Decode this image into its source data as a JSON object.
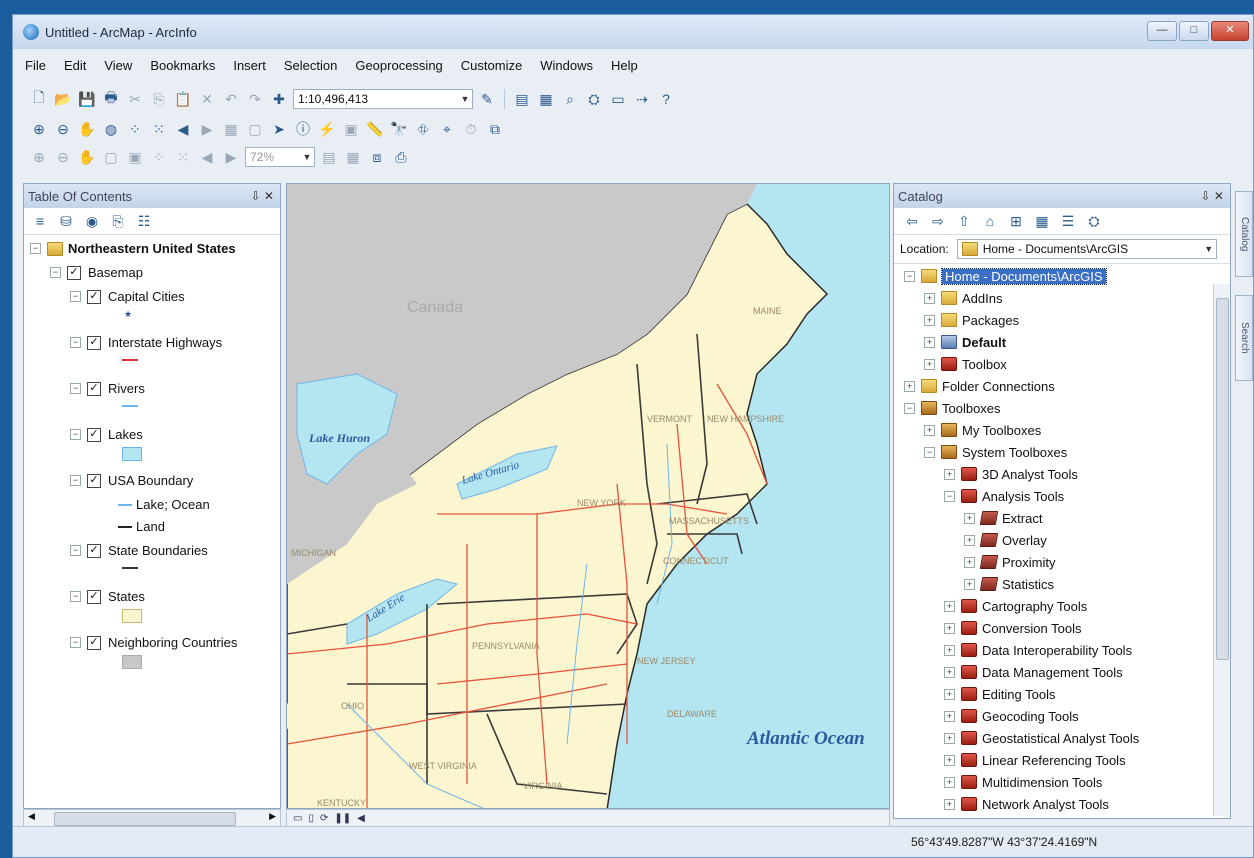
{
  "window": {
    "title": "Untitled - ArcMap - ArcInfo",
    "min": "—",
    "max": "□",
    "close": "✕"
  },
  "menu": [
    "File",
    "Edit",
    "View",
    "Bookmarks",
    "Insert",
    "Selection",
    "Geoprocessing",
    "Customize",
    "Windows",
    "Help"
  ],
  "toolbar": {
    "scale": "1:10,496,413",
    "zoom": "72%"
  },
  "toc": {
    "title": "Table Of Contents",
    "pin": "⇩ ✕",
    "group": "Northeastern United States",
    "basemap": "Basemap",
    "layers": [
      {
        "name": "Capital Cities"
      },
      {
        "name": "Interstate Highways"
      },
      {
        "name": "Rivers"
      },
      {
        "name": "Lakes"
      },
      {
        "name": "USA Boundary",
        "legend": [
          "Lake; Ocean",
          "Land"
        ]
      },
      {
        "name": "State Boundaries"
      },
      {
        "name": "States"
      },
      {
        "name": "Neighboring Countries"
      }
    ]
  },
  "map": {
    "labels": {
      "canada": "Canada",
      "lake_huron": "Lake Huron",
      "lake_ontario": "Lake Ontario",
      "lake_erie": "Lake Erie",
      "atlantic": "Atlantic Ocean",
      "maine": "MAINE",
      "vermont": "VERMONT",
      "nh": "NEW HAMPSHIRE",
      "ny": "NEW YORK",
      "ma": "MASSACHUSETTS",
      "ct": "CONNECTICUT",
      "pa": "PENNSYLVANIA",
      "nj": "NEW JERSEY",
      "oh": "OHIO",
      "wv": "WEST VIRGINIA",
      "va": "VIRGINIA",
      "ky": "KENTUCKY",
      "mi": "MICHIGAN",
      "de": "DELAWARE"
    }
  },
  "catalog": {
    "title": "Catalog",
    "pin": "⇩ ✕",
    "location_label": "Location:",
    "location_value": "Home - Documents\\ArcGIS",
    "items": [
      {
        "label": "Home - Documents\\ArcGIS"
      },
      {
        "label": "AddIns"
      },
      {
        "label": "Packages"
      },
      {
        "label": "Default"
      },
      {
        "label": "Toolbox"
      },
      {
        "label": "Folder Connections"
      },
      {
        "label": "Toolboxes"
      },
      {
        "label": "My Toolboxes"
      },
      {
        "label": "System Toolboxes"
      },
      {
        "label": "3D Analyst Tools"
      },
      {
        "label": "Analysis Tools"
      },
      {
        "label": "Extract"
      },
      {
        "label": "Overlay"
      },
      {
        "label": "Proximity"
      },
      {
        "label": "Statistics"
      },
      {
        "label": "Cartography Tools"
      },
      {
        "label": "Conversion Tools"
      },
      {
        "label": "Data Interoperability Tools"
      },
      {
        "label": "Data Management Tools"
      },
      {
        "label": "Editing Tools"
      },
      {
        "label": "Geocoding Tools"
      },
      {
        "label": "Geostatistical Analyst Tools"
      },
      {
        "label": "Linear Referencing Tools"
      },
      {
        "label": "Multidimension Tools"
      },
      {
        "label": "Network Analyst Tools"
      }
    ]
  },
  "sidetabs": [
    "Catalog",
    "Search"
  ],
  "status": {
    "coords": "56°43'49.8287\"W 43°37'24.4169\"N"
  }
}
